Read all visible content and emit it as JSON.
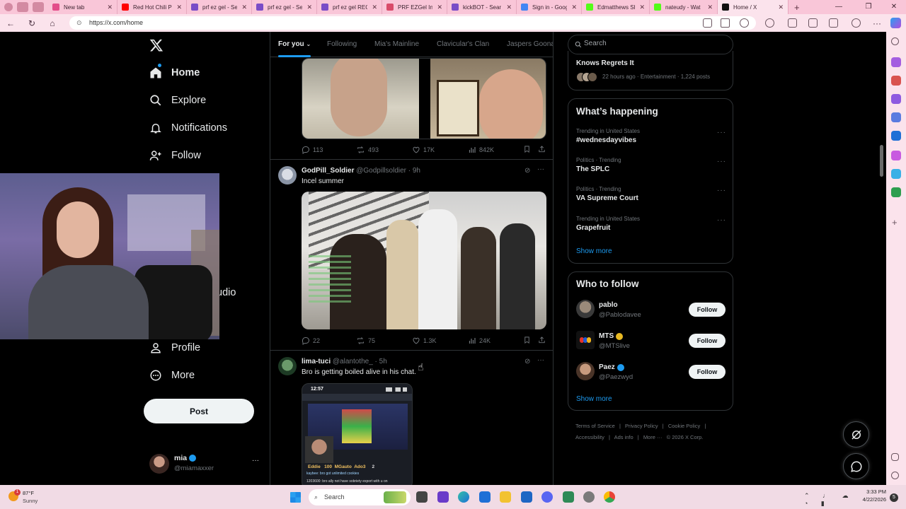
{
  "browser": {
    "tabs": [
      {
        "title": "New tab",
        "color": "#e34c8a"
      },
      {
        "title": "Red Hot Chili P",
        "color": "#ff0000"
      },
      {
        "title": "prf ez gel - Sea",
        "color": "#7a4cc7"
      },
      {
        "title": "prf ez gel - Sea",
        "color": "#7a4cc7"
      },
      {
        "title": "prf ez gel RECA",
        "color": "#7a4cc7"
      },
      {
        "title": "PRF EZGel Injec",
        "color": "#d94b6a"
      },
      {
        "title": "kickBOT - Sear",
        "color": "#7a4cc7"
      },
      {
        "title": "Sign in - Goog",
        "color": "#4285f4"
      },
      {
        "title": "Edmatthews Sh",
        "color": "#53fc18"
      },
      {
        "title": "nateudy - Wat",
        "color": "#53fc18"
      },
      {
        "title": "Home / X",
        "color": "#111111"
      }
    ],
    "url": "https://x.com/home"
  },
  "nav": {
    "items": [
      {
        "label": "Home"
      },
      {
        "label": "Explore"
      },
      {
        "label": "Notifications"
      },
      {
        "label": "Follow"
      },
      {
        "label": "udio"
      },
      {
        "label": "Profile"
      },
      {
        "label": "More"
      }
    ],
    "post_label": "Post",
    "account": {
      "name": "mia",
      "handle": "@miamaxxer"
    }
  },
  "feed": {
    "tabs": [
      "For you",
      "Following",
      "Mia's Mainline",
      "Clavicular's Clan",
      "Jaspers Goona"
    ],
    "tweets": [
      {
        "stats": {
          "replies": "113",
          "reposts": "493",
          "likes": "17K",
          "views": "842K"
        }
      },
      {
        "name": "GodPill_Soldier",
        "handle": "@Godpillsoldier · 9h",
        "text": "Incel summer",
        "media_caption": "",
        "stats": {
          "replies": "22",
          "reposts": "75",
          "likes": "1.3K",
          "views": "24K"
        }
      },
      {
        "name": "lima-tuci",
        "handle": "@alantothe_ · 5h",
        "text": "Bro is getting boiled alive in his chat.",
        "phone_time": "12:57",
        "chat_users": [
          "Eddie",
          "100",
          "MGauto",
          "Ado3",
          "2"
        ],
        "chat_lines": [
          "kaybee: bro got unlimited cookies",
          "1203600: bro ally not have sobriety export with u on"
        ]
      }
    ]
  },
  "sidebar": {
    "search_placeholder": "Search",
    "top_trend": {
      "title": "Knows Regrets It",
      "meta": "22 hours ago · Entertainment · 1,224 posts"
    },
    "whats_happening": {
      "title": "What’s happening",
      "trends": [
        {
          "meta": "Trending in United States",
          "name": "#wednesdayvibes"
        },
        {
          "meta": "Politics · Trending",
          "name": "The SPLC"
        },
        {
          "meta": "Politics · Trending",
          "name": "VA Supreme Court"
        },
        {
          "meta": "Trending in United States",
          "name": "Grapefruit"
        }
      ],
      "show_more": "Show more"
    },
    "who_to_follow": {
      "title": "Who to follow",
      "users": [
        {
          "name": "pablo",
          "handle": "@Pablodavee",
          "verified": false
        },
        {
          "name": "MTS",
          "handle": "@MTSlive",
          "verified": true,
          "badge_color": "#e8b923"
        },
        {
          "name": "Paez",
          "handle": "@Paezwyd",
          "verified": true,
          "badge_color": "#1d9bf0"
        }
      ],
      "follow_label": "Follow",
      "show_more": "Show more"
    },
    "footer": [
      "Terms of Service",
      "|",
      "Privacy Policy",
      "|",
      "Cookie Policy",
      "|",
      "Accessibility",
      "|",
      "Ads info",
      "|",
      "More ···",
      "© 2026 X Corp."
    ]
  },
  "taskbar": {
    "weather": {
      "temp": "87°F",
      "cond": "Sunny"
    },
    "search_placeholder": "Search",
    "time": "3:33 PM",
    "date": "4/22/2026",
    "notif_count": "5",
    "weather_badge": "1"
  }
}
